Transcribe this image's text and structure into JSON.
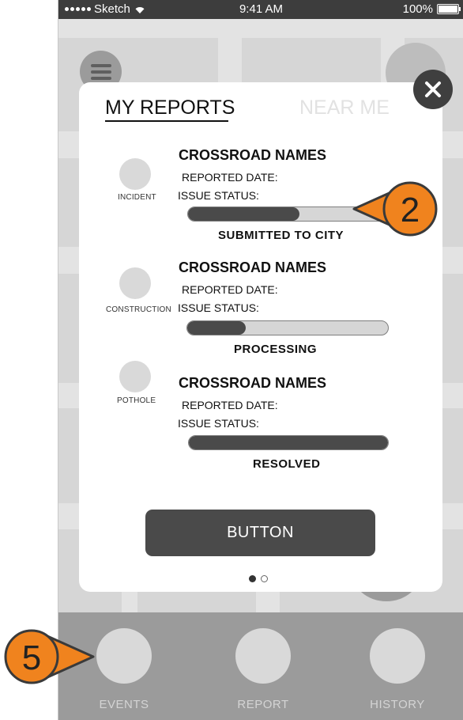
{
  "status_bar": {
    "carrier": "Sketch",
    "time": "9:41 AM",
    "battery": "100%"
  },
  "tabs": {
    "my_reports": "MY REPORTS",
    "near_me": "NEAR ME"
  },
  "reports": [
    {
      "type": "INCIDENT",
      "title": "CROSSROAD NAMES",
      "reported_date_label": "REPORTED DATE:",
      "issue_status_label": "ISSUE STATUS:",
      "status": "SUBMITTED TO  CITY",
      "progress": 0.56
    },
    {
      "type": "CONSTRUCTION",
      "title": "CROSSROAD NAMES",
      "reported_date_label": "REPORTED DATE:",
      "issue_status_label": "ISSUE STATUS:",
      "status": "PROCESSING",
      "progress": 0.29
    },
    {
      "type": "POTHOLE",
      "title": "CROSSROAD NAMES",
      "reported_date_label": "REPORTED DATE:",
      "issue_status_label": "ISSUE STATUS:",
      "status": "RESOLVED",
      "progress": 1.0
    }
  ],
  "button_label": "BUTTON",
  "pager": {
    "current": 1,
    "total": 2
  },
  "tab_bar": [
    {
      "label": "EVENTS"
    },
    {
      "label": "REPORT"
    },
    {
      "label": "HISTORY"
    }
  ],
  "callouts": [
    {
      "number": "2"
    },
    {
      "number": "5"
    }
  ],
  "colors": {
    "callout_orange": "#f0831e",
    "dark": "#4a4a4a",
    "tab_bar": "#9b9b9b"
  }
}
